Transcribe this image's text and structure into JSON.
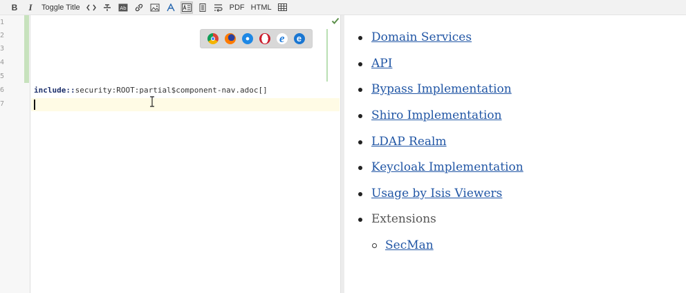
{
  "toolbar": {
    "items": [
      {
        "name": "bold-button",
        "label": "B"
      },
      {
        "name": "italic-button",
        "label": "I"
      },
      {
        "name": "toggle-title-button",
        "label": "Toggle Title"
      },
      {
        "name": "pdf-button",
        "label": "PDF"
      },
      {
        "name": "html-button",
        "label": "HTML"
      }
    ]
  },
  "editor": {
    "line_numbers": [
      "1",
      "2",
      "3",
      "4",
      "5",
      "6",
      "7"
    ],
    "code": {
      "keyword": "include::",
      "rest": "security:ROOT:partial$component-nav.adoc[]"
    }
  },
  "preview": {
    "items": [
      {
        "label": "Domain Services",
        "link": true
      },
      {
        "label": "API",
        "link": true
      },
      {
        "label": "Bypass Implementation",
        "link": true
      },
      {
        "label": "Shiro Implementation",
        "link": true
      },
      {
        "label": "LDAP Realm",
        "link": true
      },
      {
        "label": "Keycloak Implementation",
        "link": true
      },
      {
        "label": "Usage by Isis Viewers",
        "link": true
      },
      {
        "label": "Extensions",
        "link": false
      }
    ],
    "subitems": [
      {
        "label": "SecMan",
        "link": true
      }
    ]
  },
  "colors": {
    "link": "#2156a5",
    "current_line": "#fffbe5",
    "change_bar": "#c7e2bd"
  }
}
